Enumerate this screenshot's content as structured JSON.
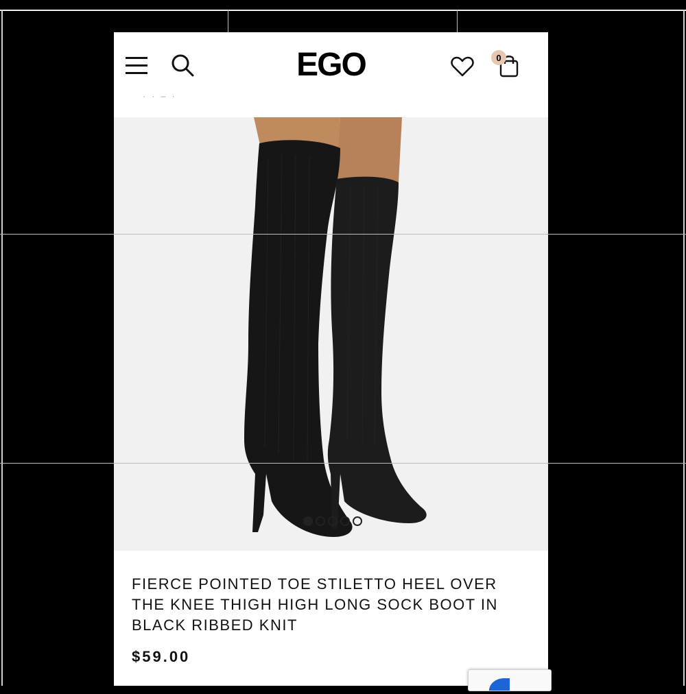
{
  "header": {
    "logo": "EGO",
    "cart_count": "0",
    "icons": [
      "menu-icon",
      "search-icon",
      "heart-icon",
      "bag-icon"
    ]
  },
  "gallery": {
    "image": "product-photo-black-thigh-high-boots",
    "slides": 5,
    "active_slide": 1
  },
  "product": {
    "title": "FIERCE POINTED TOE STILETTO HEEL OVER THE KNEE THIGH HIGH LONG SOCK BOOT IN BLACK RIBBED KNIT",
    "price": "$59.00"
  },
  "colors": {
    "background": "#000000",
    "page": "#ffffff",
    "image_bg": "#f1f1f1",
    "badge": "#e6c7b2",
    "boot": "#151515",
    "skin": "#c08a5f"
  }
}
